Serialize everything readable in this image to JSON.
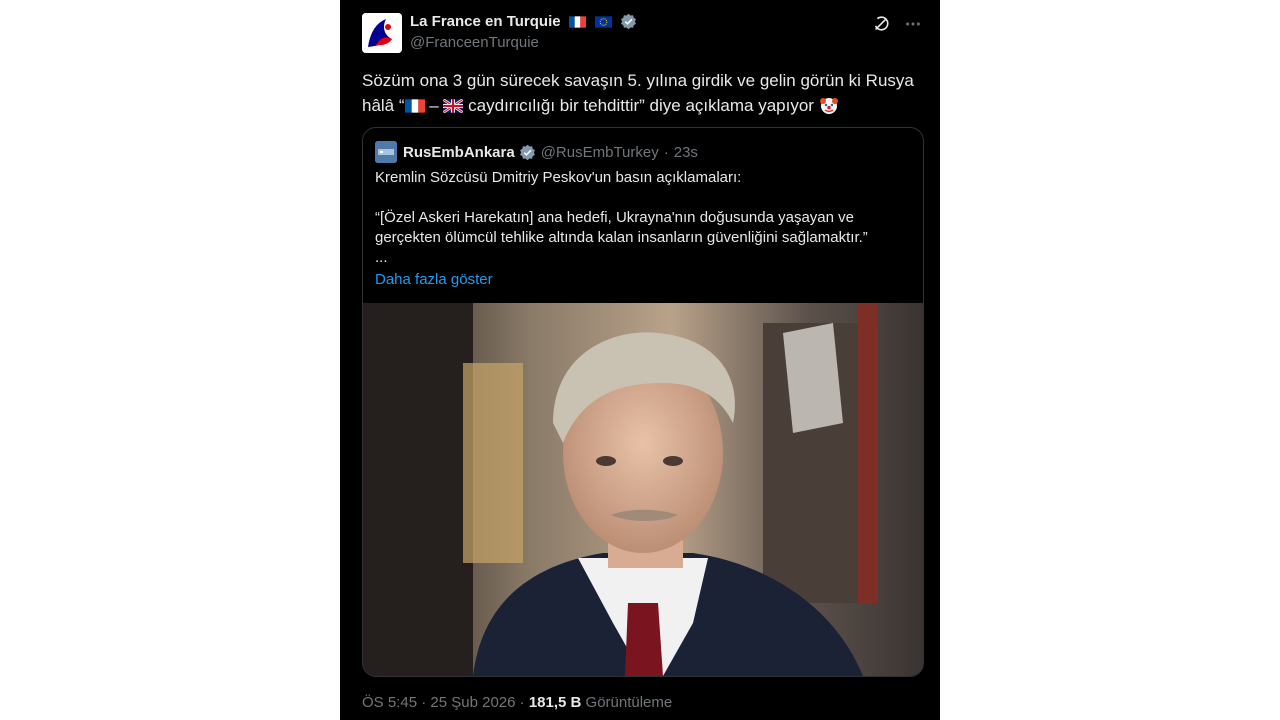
{
  "tweet": {
    "author": {
      "display_name": "La France en Turquie",
      "handle": "@FranceenTurquie",
      "flags": [
        "france-flag",
        "eu-flag"
      ],
      "verified": true
    },
    "text_before": "Sözüm ona 3 gün sürecek savaşın 5. yılına girdik ve gelin görün ki Rusya hâlâ “",
    "text_dash": " – ",
    "text_after": " caydırıcılığı bir tehdittir” diye açıklama yapıyor ",
    "text_emojis": [
      "france-flag",
      "uk-flag",
      "clown-emoji"
    ],
    "top_icons": [
      "grok-icon",
      "more-icon"
    ]
  },
  "quote": {
    "display_name": "RusEmbAnkara",
    "handle": "@RusEmbTurkey",
    "separator": "·",
    "time": "23s",
    "line1": "Kremlin Sözcüsü Dmitriy Peskov'un basın açıklamaları:",
    "line2": "“[Özel Askeri Harekatın] ana hedefi, Ukrayna'nın doğusunda yaşayan ve gerçekten ölümcül tehlike altında kalan insanların güvenliğini sağlamaktır.”",
    "line3": "...",
    "show_more": "Daha fazla göster"
  },
  "footer": {
    "time": "ÖS 5:45",
    "sep1": " · ",
    "date": "25 Şub 2026",
    "sep2": " · ",
    "views": "181,5 B",
    "views_label": " Görüntüleme"
  },
  "colors": {
    "background": "#000000",
    "text": "#e7e9ea",
    "muted": "#71767b",
    "link": "#1d9bf0",
    "border": "#2f3336"
  }
}
